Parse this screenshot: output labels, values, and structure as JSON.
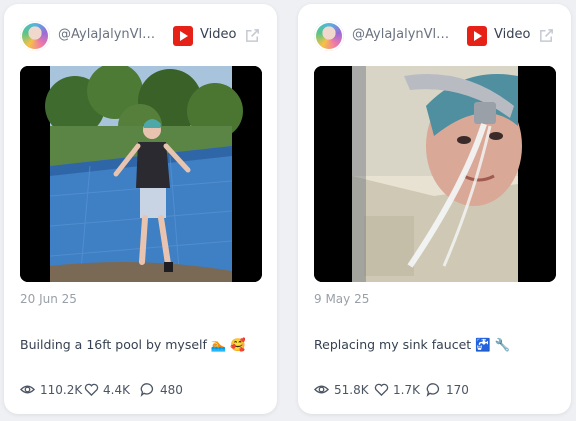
{
  "cards": [
    {
      "handle": "@AylaJalynVlo...",
      "platform_icon": "youtube-icon",
      "type_label": "Video",
      "date": "20 Jun 25",
      "caption": "Building a 16ft pool by myself 🏊 🥰",
      "views": "110.2K",
      "likes": "4.4K",
      "comments": "480"
    },
    {
      "handle": "@AylaJalynVlo...",
      "platform_icon": "youtube-icon",
      "type_label": "Video",
      "date": "9 May 25",
      "caption": "Replacing my sink faucet 🚰 🔧",
      "views": "51.8K",
      "likes": "1.7K",
      "comments": "170"
    }
  ],
  "colors": {
    "background": "#eef0f4",
    "card": "#ffffff",
    "youtube_red": "#e62117",
    "pool_blue": "#3f7fc4"
  }
}
